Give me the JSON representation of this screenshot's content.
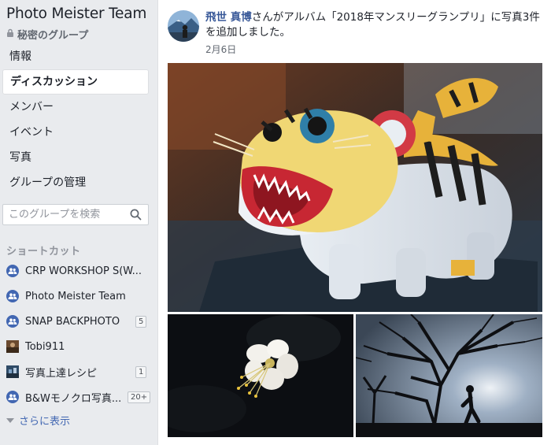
{
  "group": {
    "name": "Photo Meister Team",
    "privacy": "秘密のグループ"
  },
  "nav": [
    {
      "label": "情報"
    },
    {
      "label": "ディスカッション",
      "active": true
    },
    {
      "label": "メンバー"
    },
    {
      "label": "イベント"
    },
    {
      "label": "写真"
    },
    {
      "label": "グループの管理"
    }
  ],
  "search": {
    "placeholder": "このグループを検索"
  },
  "shortcuts": {
    "header": "ショートカット",
    "items": [
      {
        "label": "CRP WORKSHOP S(W...",
        "icon": "group-icon"
      },
      {
        "label": "Photo Meister Team",
        "icon": "group-icon"
      },
      {
        "label": "SNAP BACKPHOTO",
        "icon": "group-icon",
        "badge": "5"
      },
      {
        "label": "Tobi911",
        "icon": "page-thumbnail"
      },
      {
        "label": "写真上達レシピ",
        "icon": "page-thumbnail",
        "badge": "1"
      },
      {
        "label": "B&Wモノクロ写真...",
        "icon": "group-icon",
        "badge": "20+"
      }
    ],
    "see_more": "さらに表示"
  },
  "post": {
    "author": "飛世 真博",
    "action_text": "さんがアルバム「2018年マンスリーグランプリ」に写真3件を追加しました。",
    "date": "2月6日"
  },
  "colors": {
    "link": "#385898",
    "brand": "#4267b2",
    "background": "#e9ebee"
  }
}
